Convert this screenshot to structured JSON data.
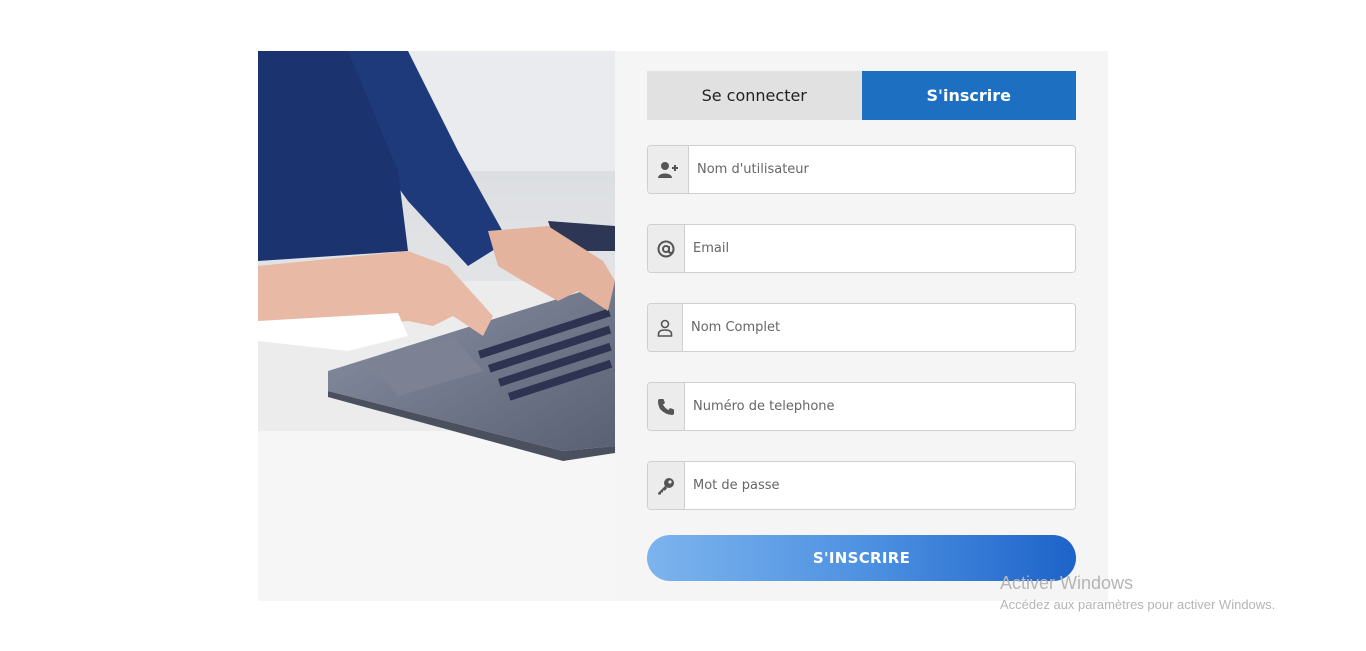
{
  "tabs": {
    "login_label": "Se connecter",
    "signup_label": "S'inscrire"
  },
  "fields": [
    {
      "name": "username",
      "icon": "user-plus-icon",
      "placeholder": "Nom d'utilisateur"
    },
    {
      "name": "email",
      "icon": "at-icon",
      "placeholder": "Email"
    },
    {
      "name": "fullname",
      "icon": "user-icon",
      "placeholder": "Nom Complet"
    },
    {
      "name": "phone",
      "icon": "phone-icon",
      "placeholder": "Numéro de telephone"
    },
    {
      "name": "password",
      "icon": "key-icon",
      "placeholder": "Mot de passe"
    }
  ],
  "submit_label": "S'INSCRIRE",
  "watermark": {
    "title": "Activer Windows",
    "subtitle": "Accédez aux paramètres pour activer Windows."
  },
  "colors": {
    "accent": "#1d6fc1",
    "panel_bg": "#f5f5f5",
    "button_gradient_start": "#7db4ee",
    "button_gradient_end": "#1d63c9"
  },
  "image": {
    "description_icon": "laptop-typing-photo"
  }
}
